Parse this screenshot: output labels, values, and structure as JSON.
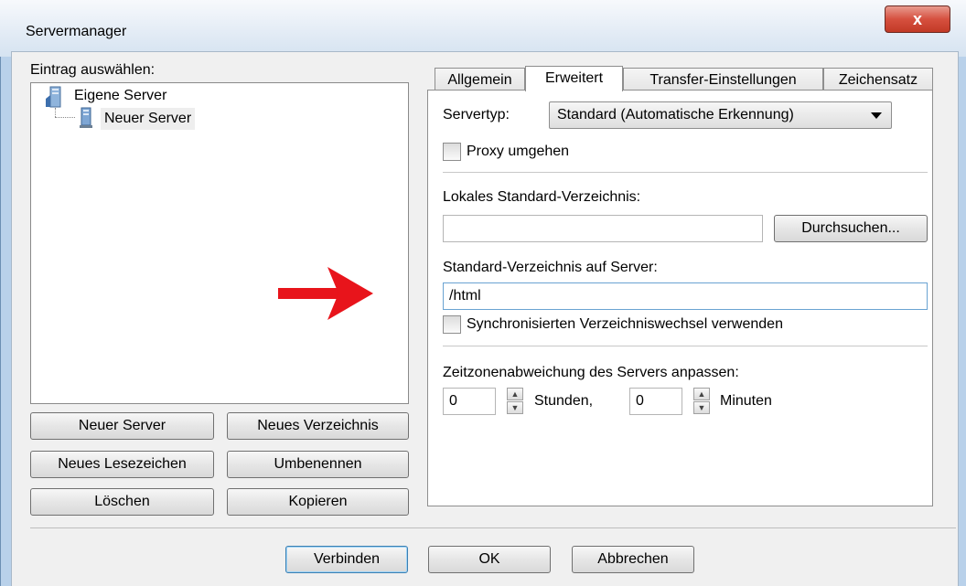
{
  "window": {
    "title": "Servermanager",
    "close_label": "x"
  },
  "left": {
    "select_label": "Eintrag auswählen:",
    "tree": {
      "root_label": "Eigene Server",
      "child_label": "Neuer Server"
    },
    "buttons": {
      "new_server": "Neuer Server",
      "new_folder": "Neues Verzeichnis",
      "new_bookmark": "Neues Lesezeichen",
      "rename": "Umbenennen",
      "delete": "Löschen",
      "copy": "Kopieren"
    }
  },
  "tabs": {
    "general": "Allgemein",
    "advanced": "Erweitert",
    "transfer": "Transfer-Einstellungen",
    "charset": "Zeichensatz"
  },
  "advanced": {
    "server_type_label": "Servertyp:",
    "server_type_value": "Standard (Automatische Erkennung)",
    "bypass_proxy_label": "Proxy umgehen",
    "local_dir_label": "Lokales Standard-Verzeichnis:",
    "local_dir_value": "",
    "browse_label": "Durchsuchen...",
    "remote_dir_label": "Standard-Verzeichnis auf Server:",
    "remote_dir_value": "/html",
    "sync_browsing_label": "Synchronisierten Verzeichniswechsel verwenden",
    "timezone_label": "Zeitzonenabweichung des Servers anpassen:",
    "hours_value": "0",
    "hours_label": "Stunden,",
    "minutes_value": "0",
    "minutes_label": "Minuten"
  },
  "footer": {
    "connect": "Verbinden",
    "ok": "OK",
    "cancel": "Abbrechen"
  },
  "colors": {
    "arrow": "#e8141b",
    "window_frame": "#b9d1ea",
    "client_bg": "#f0f0f0",
    "close_button": "#c9432e"
  },
  "icons": {
    "tree_root": "folder-server-icon",
    "tree_child": "server-icon",
    "dropdown": "triangle-down-icon",
    "annotation": "red-arrow-icon"
  }
}
